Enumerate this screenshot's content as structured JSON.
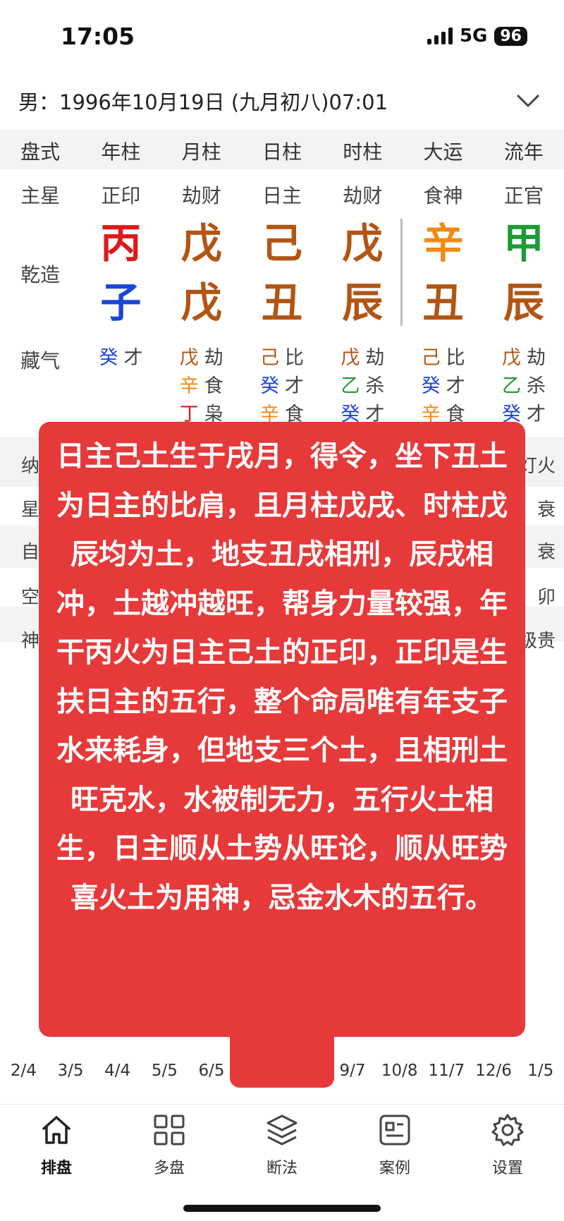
{
  "status": {
    "time": "17:05",
    "network": "5G",
    "battery": "96"
  },
  "header": {
    "profile": "男：1996年10月19日 (九月初八)07:01"
  },
  "colors": {
    "fire": "#e0191c",
    "earth": "#b25513",
    "water": "#1a46d8",
    "metal": "#ef8a12",
    "wood": "#1e9a36",
    "overlay": "#e6393a"
  },
  "table": {
    "headers": [
      "盘式",
      "年柱",
      "月柱",
      "日柱",
      "时柱",
      "大运",
      "流年"
    ],
    "main_star_label": "主星",
    "main_stars": [
      "正印",
      "劫财",
      "日主",
      "劫财",
      "食神",
      "正官"
    ],
    "pillar_label": "乾造",
    "stems": [
      "丙",
      "戊",
      "己",
      "戊",
      "辛",
      "甲"
    ],
    "branches": [
      "子",
      "戊",
      "丑",
      "辰",
      "丑",
      "辰"
    ],
    "hidden_label": "藏气",
    "hidden_stems": [
      [
        {
          "g": "癸",
          "s": "才",
          "c": "water"
        }
      ],
      [
        {
          "g": "戊",
          "s": "劫",
          "c": "earth"
        },
        {
          "g": "辛",
          "s": "食",
          "c": "metal"
        },
        {
          "g": "丁",
          "s": "枭",
          "c": "fire"
        }
      ],
      [
        {
          "g": "己",
          "s": "比",
          "c": "earth"
        },
        {
          "g": "癸",
          "s": "才",
          "c": "water"
        },
        {
          "g": "辛",
          "s": "食",
          "c": "metal"
        }
      ],
      [
        {
          "g": "戊",
          "s": "劫",
          "c": "earth"
        },
        {
          "g": "乙",
          "s": "杀",
          "c": "wood"
        },
        {
          "g": "癸",
          "s": "才",
          "c": "water"
        }
      ],
      [
        {
          "g": "己",
          "s": "比",
          "c": "earth"
        },
        {
          "g": "癸",
          "s": "才",
          "c": "water"
        },
        {
          "g": "辛",
          "s": "食",
          "c": "metal"
        }
      ],
      [
        {
          "g": "戊",
          "s": "劫",
          "c": "earth"
        },
        {
          "g": "乙",
          "s": "杀",
          "c": "wood"
        },
        {
          "g": "癸",
          "s": "才",
          "c": "water"
        }
      ]
    ]
  },
  "obscured_rows": {
    "nayin_label": "纳",
    "nayin_right": "灯火",
    "star_label": "星",
    "star_right": "衰",
    "self_label": "自",
    "self_right": "衰",
    "kong_label": "空",
    "kong_right": "卯",
    "shen_label": "神",
    "shen_right": "级贵"
  },
  "overlay": {
    "text": "日主己土生于戌月，得令，坐下丑土为日主的比肩，且月柱戊戌、时柱戊辰均为土，地支丑戌相刑，辰戌相冲，土越冲越旺，帮身力量较强，年干丙火为日主己土的正印，正印是生扶日主的五行，整个命局唯有年支子水来耗身，但地支三个土，且相刑土旺克水，水被制无力，五行火土相生，日主顺从土势从旺论，顺从旺势喜火土为用神，忌金水木的五行。"
  },
  "bottom_dates": [
    "2/4",
    "3/5",
    "4/4",
    "5/5",
    "6/5",
    "",
    "",
    "9/7",
    "10/8",
    "11/7",
    "12/6",
    "1/5"
  ],
  "tabs": [
    {
      "label": "排盘",
      "icon": "home-icon"
    },
    {
      "label": "多盘",
      "icon": "grid-icon"
    },
    {
      "label": "断法",
      "icon": "layers-icon"
    },
    {
      "label": "案例",
      "icon": "card-icon"
    },
    {
      "label": "设置",
      "icon": "gear-icon"
    }
  ]
}
